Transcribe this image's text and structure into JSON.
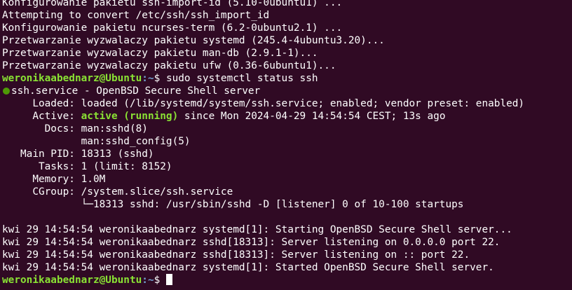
{
  "terminal": {
    "prompt_user": "weronikaabednarz@Ubuntu",
    "prompt_path": ":~",
    "prompt_symbol": "$",
    "command": " sudo systemctl status ssh",
    "lines_before": [
      "Konfigurowanie pakietu ssh-import-id (5.10-0ubuntu1) ...",
      "Attempting to convert /etc/ssh/ssh_import_id",
      "Konfigurowanie pakietu ncurses-term (6.2-0ubuntu2.1) ...",
      "Przetwarzanie wyzwalaczy pakietu systemd (245.4-4ubuntu3.20)...",
      "Przetwarzanie wyzwalaczy pakietu man-db (2.9.1-1)...",
      "Przetwarzanie wyzwalaczy pakietu ufw (0.36-6ubuntu1)..."
    ],
    "status": {
      "service_line": "ssh.service - OpenBSD Secure Shell server",
      "loaded": "     Loaded: loaded (/lib/systemd/system/ssh.service; enabled; vendor preset: enabled)",
      "active_label": "     Active: ",
      "active_value": "active (running)",
      "active_rest": " since Mon 2024-04-29 14:54:54 CEST; 13s ago",
      "docs_1": "       Docs: man:sshd(8)",
      "docs_2": "             man:sshd_config(5)",
      "main_pid": "   Main PID: 18313 (sshd)",
      "tasks": "      Tasks: 1 (limit: 8152)",
      "memory": "     Memory: 1.0M",
      "cgroup": "     CGroup: /system.slice/ssh.service",
      "cgroup_child": "             └─18313 sshd: /usr/sbin/sshd -D [listener] 0 of 10-100 startups"
    },
    "log_lines": [
      "kwi 29 14:54:54 weronikaabednarz systemd[1]: Starting OpenBSD Secure Shell server...",
      "kwi 29 14:54:54 weronikaabednarz sshd[18313]: Server listening on 0.0.0.0 port 22.",
      "kwi 29 14:54:54 weronikaabednarz sshd[18313]: Server listening on :: port 22.",
      "kwi 29 14:54:54 weronikaabednarz systemd[1]: Started OpenBSD Secure Shell server."
    ],
    "colors": {
      "background": "#300a24",
      "text": "#ffffff",
      "prompt_user": "#8ae234",
      "prompt_path": "#729fcf",
      "active_green": "#8ae234",
      "status_dot": "#4e9a06"
    }
  }
}
